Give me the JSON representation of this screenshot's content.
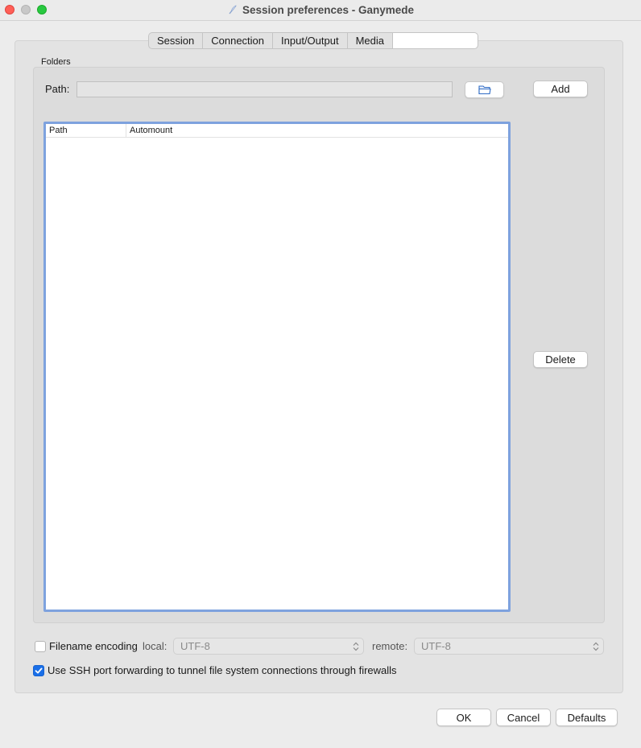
{
  "window": {
    "title": "Session preferences - Ganymede"
  },
  "tabs": [
    {
      "label": "Session"
    },
    {
      "label": "Connection"
    },
    {
      "label": "Input/Output"
    },
    {
      "label": "Media"
    },
    {
      "label": ""
    }
  ],
  "folders": {
    "group_label": "Folders",
    "path_label": "Path:",
    "path_value": "",
    "add_label": "Add",
    "delete_label": "Delete",
    "columns": [
      "Path",
      "Automount"
    ],
    "rows": []
  },
  "encoding": {
    "checkbox_label": "Filename encoding",
    "checked": false,
    "local_label": "local:",
    "local_value": "UTF-8",
    "remote_label": "remote:",
    "remote_value": "UTF-8"
  },
  "ssh": {
    "label": "Use SSH port forwarding to tunnel file system connections through firewalls",
    "checked": true
  },
  "footer": {
    "ok_label": "OK",
    "cancel_label": "Cancel",
    "defaults_label": "Defaults"
  },
  "colors": {
    "accent": "#1a6fe8",
    "list_focus": "#7ea2de"
  }
}
